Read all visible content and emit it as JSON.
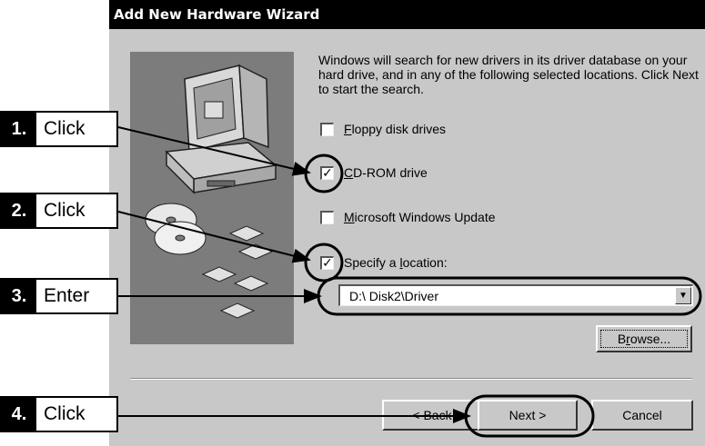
{
  "window": {
    "title": "Add New Hardware Wizard",
    "intro": "Windows will search for new drivers in its driver database on your hard drive, and in any of the following selected locations. Click Next to start the search."
  },
  "options": [
    {
      "pre": "",
      "key": "F",
      "post": "loppy disk drives",
      "checked": false
    },
    {
      "pre": "",
      "key": "C",
      "post": "D-ROM drive",
      "checked": true
    },
    {
      "pre": "",
      "key": "M",
      "post": "icrosoft Windows Update",
      "checked": false
    },
    {
      "pre": "Specify a ",
      "key": "l",
      "post": "ocation:",
      "checked": true
    }
  ],
  "check_mark": "✓",
  "location": {
    "value": "D:\\ Disk2\\Driver",
    "arrow": "▼"
  },
  "buttons": {
    "browse_pre": "B",
    "browse_key": "r",
    "browse_post": "owse...",
    "back": "< Back",
    "next": "Next >",
    "cancel": "Cancel"
  },
  "callouts": [
    {
      "num": "1.",
      "word": "Click"
    },
    {
      "num": "2.",
      "word": "Click"
    },
    {
      "num": "3.",
      "word": "Enter"
    },
    {
      "num": "4.",
      "word": "Click"
    }
  ],
  "colors": {
    "titlebar": "#000000",
    "dialog": "#c8c8c8",
    "art_panel": "#7c7c7c"
  },
  "icons": [
    "computer-illustration-icon",
    "cd-disc-icon",
    "floppy-disk-icon",
    "dropdown-arrow-icon"
  ]
}
